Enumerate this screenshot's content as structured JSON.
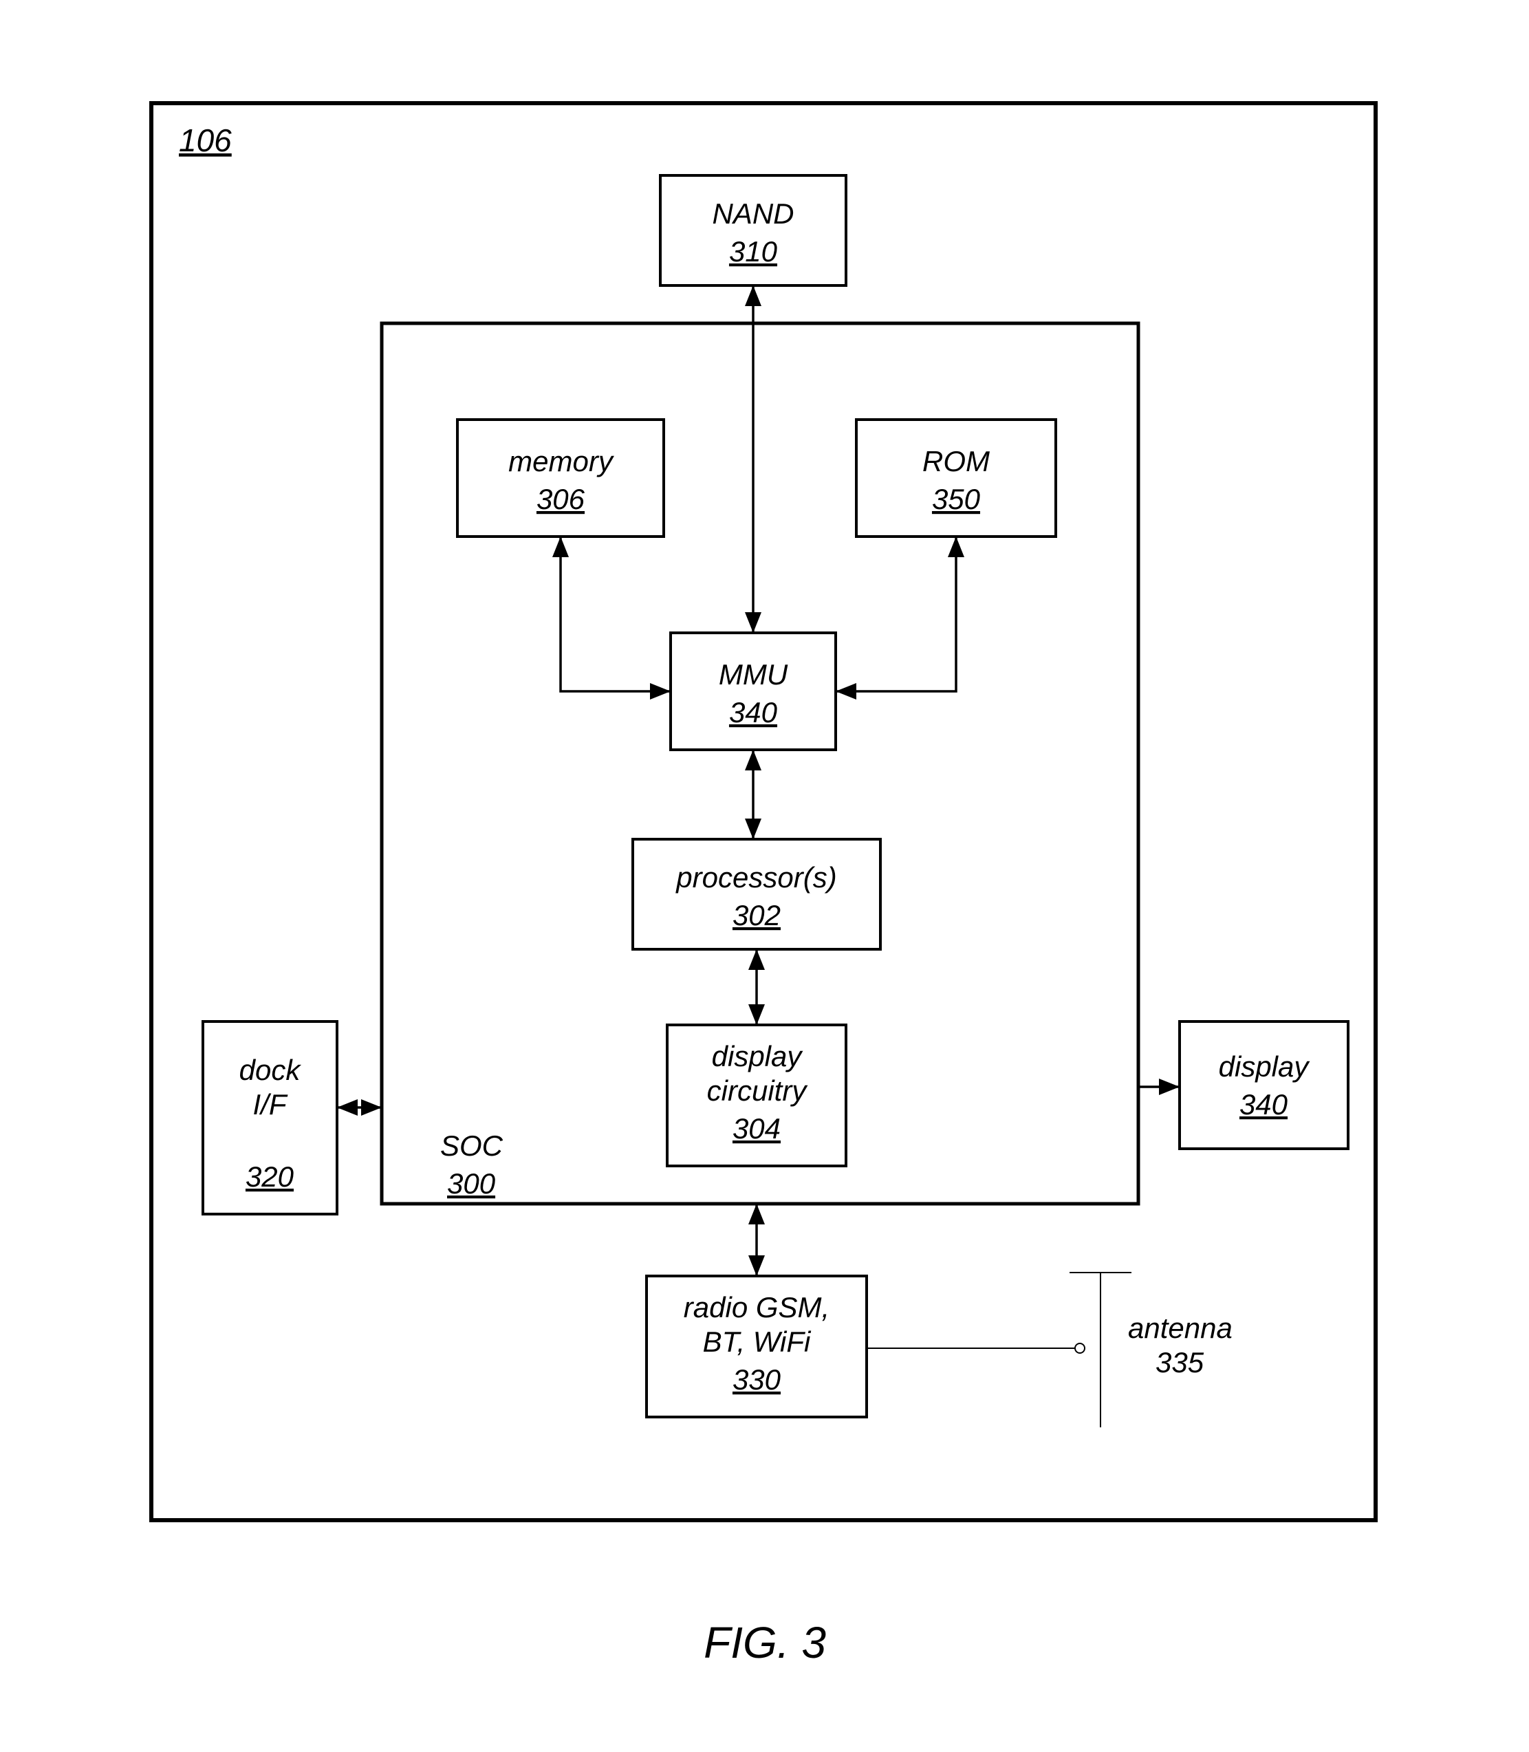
{
  "figure_label": "FIG. 3",
  "outer_ref": "106",
  "blocks": {
    "nand": {
      "label": "NAND",
      "ref": "310"
    },
    "memory": {
      "label": "memory",
      "ref": "306"
    },
    "rom": {
      "label": "ROM",
      "ref": "350"
    },
    "mmu": {
      "label": "MMU",
      "ref": "340"
    },
    "proc": {
      "label": "processor(s)",
      "ref": "302"
    },
    "dispcirc": {
      "label1": "display",
      "label2": "circuitry",
      "ref": "304"
    },
    "soc": {
      "label": "SOC",
      "ref": "300"
    },
    "dock": {
      "label1": "dock",
      "label2": "I/F",
      "ref": "320"
    },
    "display": {
      "label": "display",
      "ref": "340"
    },
    "radio": {
      "label1": "radio GSM,",
      "label2": "BT, WiFi",
      "ref": "330"
    },
    "antenna": {
      "label": "antenna",
      "ref": "335"
    }
  }
}
